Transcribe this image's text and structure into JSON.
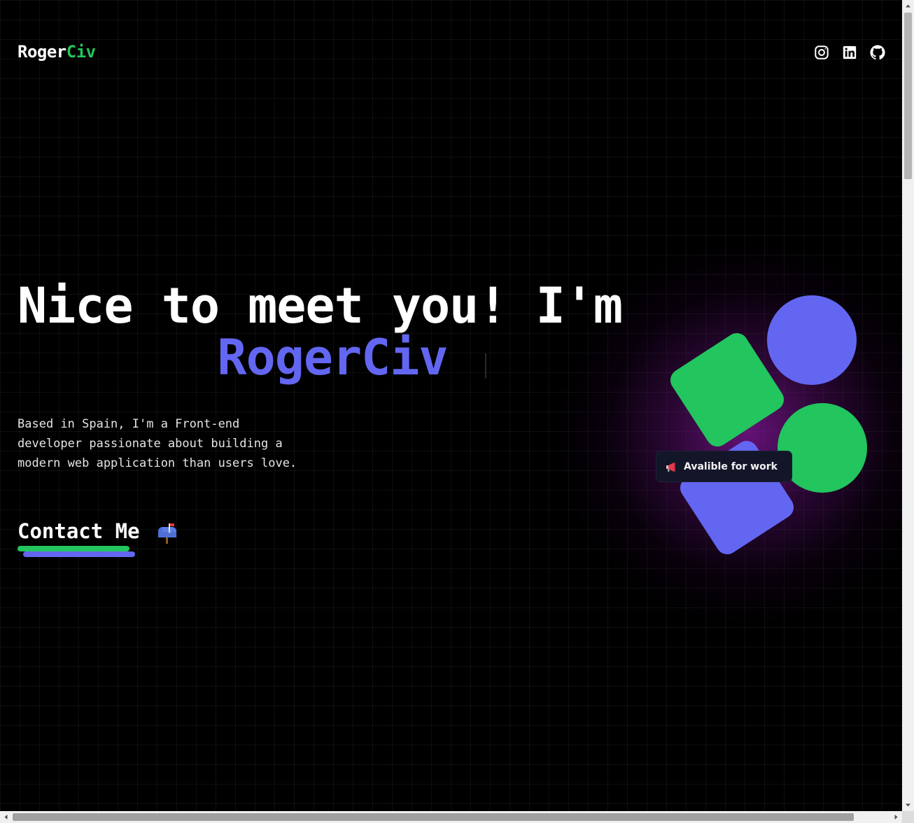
{
  "header": {
    "logo_primary": "Roger",
    "logo_accent": "Civ",
    "socials": [
      {
        "icon": "instagram-icon"
      },
      {
        "icon": "linkedin-icon"
      },
      {
        "icon": "github-icon"
      }
    ]
  },
  "hero": {
    "title_line1": "Nice to meet you! I'm",
    "title_line2": "RogerCiv",
    "bio": "Based in Spain, I'm a Front-end developer passionate about building a modern web application than users love.",
    "contact_label": "Contact Me",
    "contact_icon": "mailbox-icon"
  },
  "badge": {
    "icon": "megaphone-icon",
    "text": "Avalible for work"
  },
  "colors": {
    "accent_green": "#22c55e",
    "accent_blue": "#6366f1",
    "background": "#000000",
    "glow": "#801696"
  }
}
